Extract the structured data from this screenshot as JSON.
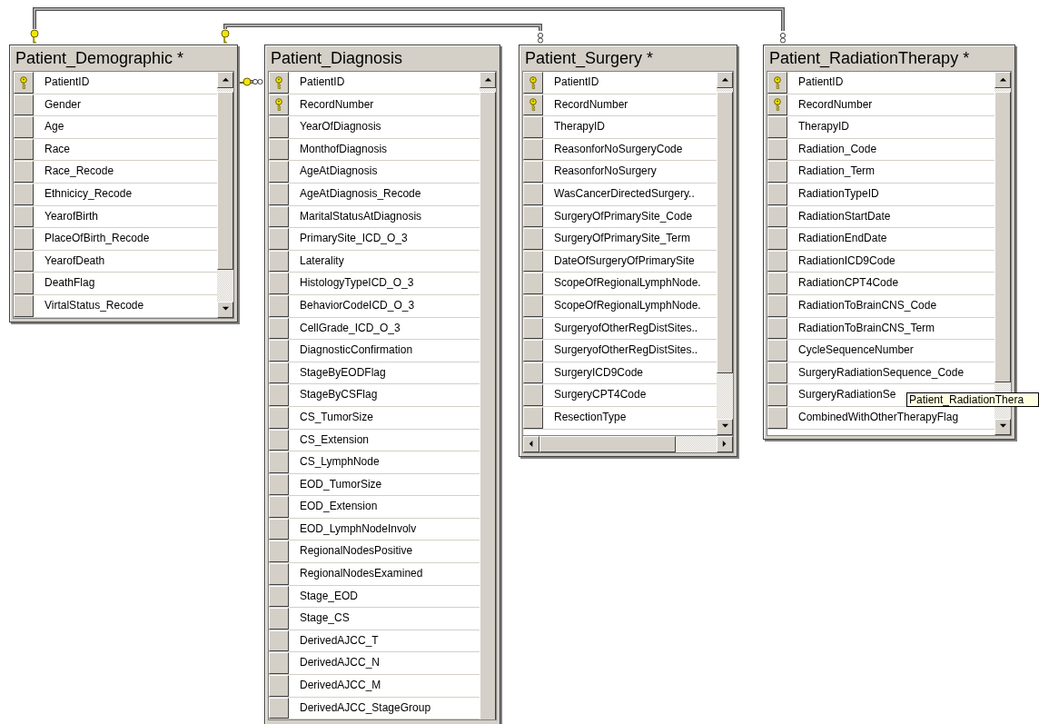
{
  "tables": [
    {
      "title": "Patient_Demographic *",
      "rows": [
        {
          "name": "PatientID",
          "key": true
        },
        {
          "name": "Gender",
          "key": false
        },
        {
          "name": "Age",
          "key": false
        },
        {
          "name": "Race",
          "key": false
        },
        {
          "name": "Race_Recode",
          "key": false
        },
        {
          "name": "Ethnicicy_Recode",
          "key": false
        },
        {
          "name": "YearofBirth",
          "key": false
        },
        {
          "name": "PlaceOfBirth_Recode",
          "key": false
        },
        {
          "name": "YearofDeath",
          "key": false
        },
        {
          "name": "DeathFlag",
          "key": false
        },
        {
          "name": "VirtalStatus_Recode",
          "key": false
        }
      ]
    },
    {
      "title": "Patient_Diagnosis",
      "rows": [
        {
          "name": "PatientID",
          "key": true
        },
        {
          "name": "RecordNumber",
          "key": true
        },
        {
          "name": "YearOfDiagnosis",
          "key": false
        },
        {
          "name": "MonthofDiagnosis",
          "key": false
        },
        {
          "name": "AgeAtDiagnosis",
          "key": false
        },
        {
          "name": "AgeAtDiagnosis_Recode",
          "key": false
        },
        {
          "name": "MaritalStatusAtDiagnosis",
          "key": false
        },
        {
          "name": "PrimarySite_ICD_O_3",
          "key": false
        },
        {
          "name": "Laterality",
          "key": false
        },
        {
          "name": "HistologyTypeICD_O_3",
          "key": false
        },
        {
          "name": "BehaviorCodeICD_O_3",
          "key": false
        },
        {
          "name": "CellGrade_ICD_O_3",
          "key": false
        },
        {
          "name": "DiagnosticConfirmation",
          "key": false
        },
        {
          "name": "StageByEODFlag",
          "key": false
        },
        {
          "name": "StageByCSFlag",
          "key": false
        },
        {
          "name": "CS_TumorSize",
          "key": false
        },
        {
          "name": "CS_Extension",
          "key": false
        },
        {
          "name": "CS_LymphNode",
          "key": false
        },
        {
          "name": "EOD_TumorSize",
          "key": false
        },
        {
          "name": "EOD_Extension",
          "key": false
        },
        {
          "name": "EOD_LymphNodeInvolv",
          "key": false
        },
        {
          "name": "RegionalNodesPositive",
          "key": false
        },
        {
          "name": "RegionalNodesExamined",
          "key": false
        },
        {
          "name": "Stage_EOD",
          "key": false
        },
        {
          "name": "Stage_CS",
          "key": false
        },
        {
          "name": "DerivedAJCC_T",
          "key": false
        },
        {
          "name": "DerivedAJCC_N",
          "key": false
        },
        {
          "name": "DerivedAJCC_M",
          "key": false
        },
        {
          "name": "DerivedAJCC_StageGroup",
          "key": false
        }
      ]
    },
    {
      "title": "Patient_Surgery *",
      "rows": [
        {
          "name": "PatientID",
          "key": true
        },
        {
          "name": "RecordNumber",
          "key": true
        },
        {
          "name": "TherapyID",
          "key": false
        },
        {
          "name": "ReasonforNoSurgeryCode",
          "key": false
        },
        {
          "name": "ReasonforNoSurgery",
          "key": false
        },
        {
          "name": "WasCancerDirectedSurgery..",
          "key": false
        },
        {
          "name": "SurgeryOfPrimarySite_Code",
          "key": false
        },
        {
          "name": "SurgeryOfPrimarySite_Term",
          "key": false
        },
        {
          "name": "DateOfSurgeryOfPrimarySite",
          "key": false
        },
        {
          "name": "ScopeOfRegionalLymphNode.",
          "key": false
        },
        {
          "name": "ScopeOfRegionalLymphNode.",
          "key": false
        },
        {
          "name": "SurgeryofOtherRegDistSites..",
          "key": false
        },
        {
          "name": "SurgeryofOtherRegDistSites..",
          "key": false
        },
        {
          "name": "SurgeryICD9Code",
          "key": false
        },
        {
          "name": "SurgeryCPT4Code",
          "key": false
        },
        {
          "name": "ResectionType",
          "key": false
        }
      ]
    },
    {
      "title": "Patient_RadiationTherapy *",
      "rows": [
        {
          "name": "PatientID",
          "key": true
        },
        {
          "name": "RecordNumber",
          "key": true
        },
        {
          "name": "TherapyID",
          "key": false
        },
        {
          "name": "Radiation_Code",
          "key": false
        },
        {
          "name": "Radiation_Term",
          "key": false
        },
        {
          "name": "RadiationTypeID",
          "key": false
        },
        {
          "name": "RadiationStartDate",
          "key": false
        },
        {
          "name": "RadiationEndDate",
          "key": false
        },
        {
          "name": "RadiationICD9Code",
          "key": false
        },
        {
          "name": "RadiationCPT4Code",
          "key": false
        },
        {
          "name": "RadiationToBrainCNS_Code",
          "key": false
        },
        {
          "name": "RadiationToBrainCNS_Term",
          "key": false
        },
        {
          "name": "CycleSequenceNumber",
          "key": false
        },
        {
          "name": "SurgeryRadiationSequence_Code",
          "key": false
        },
        {
          "name": "SurgeryRadiationSe",
          "key": false
        },
        {
          "name": "CombinedWithOtherTherapyFlag",
          "key": false
        }
      ]
    }
  ],
  "tooltip": {
    "text": "Patient_RadiationThera"
  }
}
